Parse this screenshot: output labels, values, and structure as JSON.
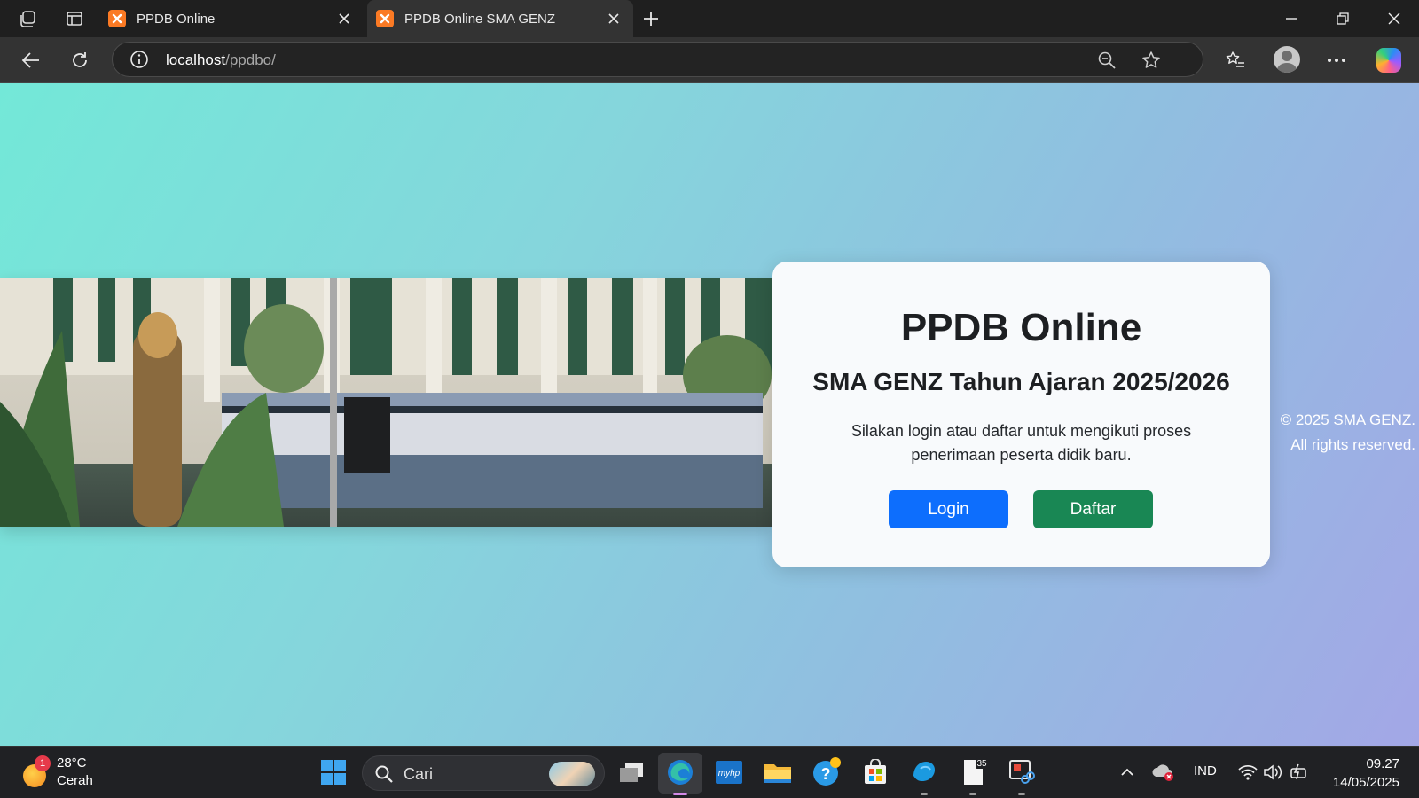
{
  "browser": {
    "tabs": [
      {
        "title": "PPDB Online",
        "active": false
      },
      {
        "title": "PPDB Online SMA GENZ",
        "active": true
      }
    ],
    "url_host": "localhost",
    "url_path": "/ppdbo/"
  },
  "page": {
    "title": "PPDB Online",
    "subtitle": "SMA GENZ Tahun Ajaran 2025/2026",
    "description": "Silakan login atau daftar untuk mengikuti proses penerimaan peserta didik baru.",
    "login_label": "Login",
    "register_label": "Daftar",
    "footer_line1": "© 2025 SMA GENZ.",
    "footer_line2": "All rights reserved."
  },
  "taskbar": {
    "weather_badge": "1",
    "temperature": "28°C",
    "condition": "Cerah",
    "search_placeholder": "Cari",
    "notes_badge": "35",
    "language": "IND",
    "time": "09.27",
    "date": "14/05/2025"
  },
  "colors": {
    "login_button": "#0d6efd",
    "register_button": "#198754",
    "tab_active": "#333333",
    "favicon": "#fb7a24"
  }
}
